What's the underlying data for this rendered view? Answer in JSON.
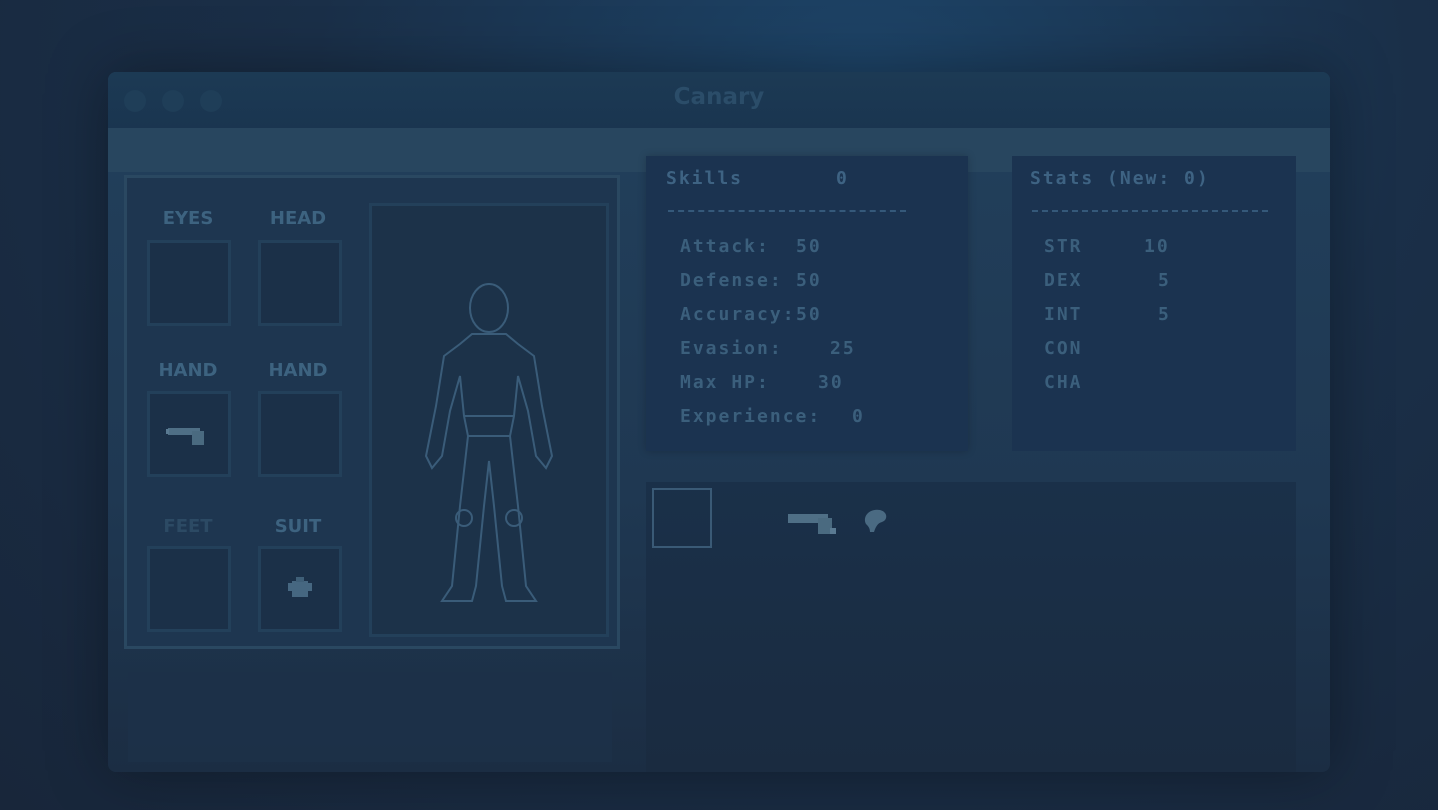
{
  "window": {
    "title": "Canary"
  },
  "equipment": {
    "slots": [
      {
        "label": "EYES"
      },
      {
        "label": "HEAD"
      },
      {
        "label": "HAND"
      },
      {
        "label": "HAND"
      },
      {
        "label": "FEET"
      },
      {
        "label": "SUIT"
      }
    ]
  },
  "skills": {
    "header": "Skills",
    "points": "0",
    "rows": [
      {
        "label": "Attack:",
        "value": "50"
      },
      {
        "label": "Defense:",
        "value": "50"
      },
      {
        "label": "Accuracy:",
        "value": "50"
      },
      {
        "label": "Evasion:",
        "value": "25"
      },
      {
        "label": "Max HP:",
        "value": "30"
      },
      {
        "label": "Experience:",
        "value": "0"
      }
    ]
  },
  "stats": {
    "header": "Stats (New: 0)",
    "rows": [
      {
        "label": "STR",
        "value": "10"
      },
      {
        "label": "DEX",
        "value": "5"
      },
      {
        "label": "INT",
        "value": "5"
      },
      {
        "label": "CON",
        "value": ""
      },
      {
        "label": "CHA",
        "value": ""
      }
    ]
  },
  "icons": {
    "equipped_hand": "pistol-icon",
    "equipped_suit": "suit-icon",
    "inventory": [
      "pistol-icon",
      "brain-icon"
    ]
  },
  "colors": {
    "accent": "#3b5f7c",
    "background": "#1a2f48"
  }
}
